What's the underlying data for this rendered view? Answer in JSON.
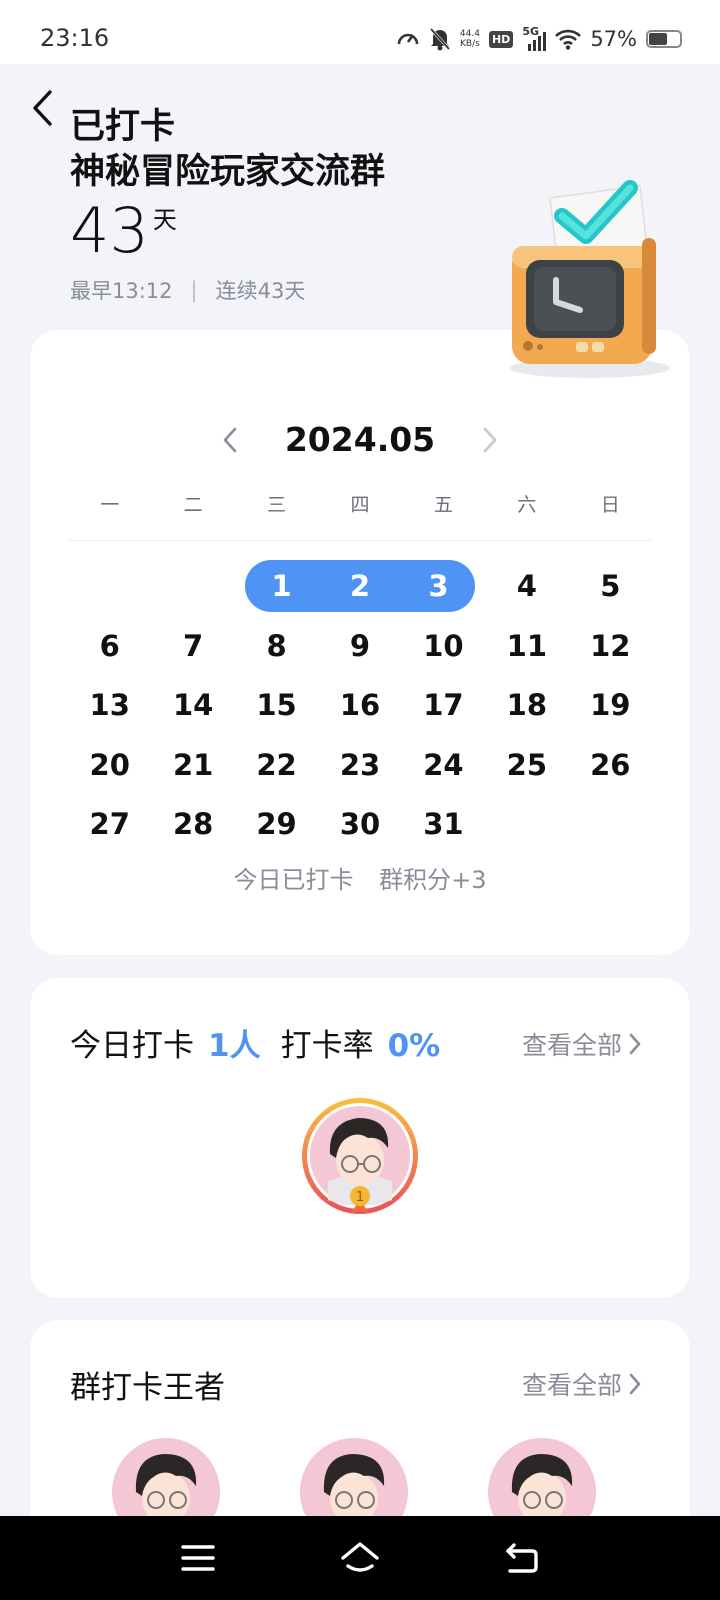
{
  "status_bar": {
    "time": "23:16",
    "net_speed_value": "44.4",
    "net_speed_unit": "KB/s",
    "hd_label": "HD",
    "network_label": "5G",
    "battery_text": "57%"
  },
  "header": {
    "title": "已打卡",
    "group_name": "神秘冒险玩家交流群",
    "days_count": "43",
    "days_unit": "天",
    "earliest": "最早13:12",
    "separator": "|",
    "streak": "连续43天"
  },
  "calendar": {
    "month": "2024.05",
    "weekdays": [
      "一",
      "二",
      "三",
      "四",
      "五",
      "六",
      "日"
    ],
    "leading_blanks": 2,
    "days": [
      "1",
      "2",
      "3",
      "4",
      "5",
      "6",
      "7",
      "8",
      "9",
      "10",
      "11",
      "12",
      "13",
      "14",
      "15",
      "16",
      "17",
      "18",
      "19",
      "20",
      "21",
      "22",
      "23",
      "24",
      "25",
      "26",
      "27",
      "28",
      "29",
      "30",
      "31"
    ],
    "checked_days": [
      "1",
      "2",
      "3"
    ],
    "footer_status": "今日已打卡",
    "footer_points": "群积分+3",
    "accent_color": "#4f94f5"
  },
  "today": {
    "label": "今日打卡",
    "count": "1人",
    "rate_label": "打卡率",
    "rate": "0%",
    "view_all": "查看全部",
    "badge_rank": "1"
  },
  "king": {
    "title": "群打卡王者",
    "view_all": "查看全部"
  }
}
